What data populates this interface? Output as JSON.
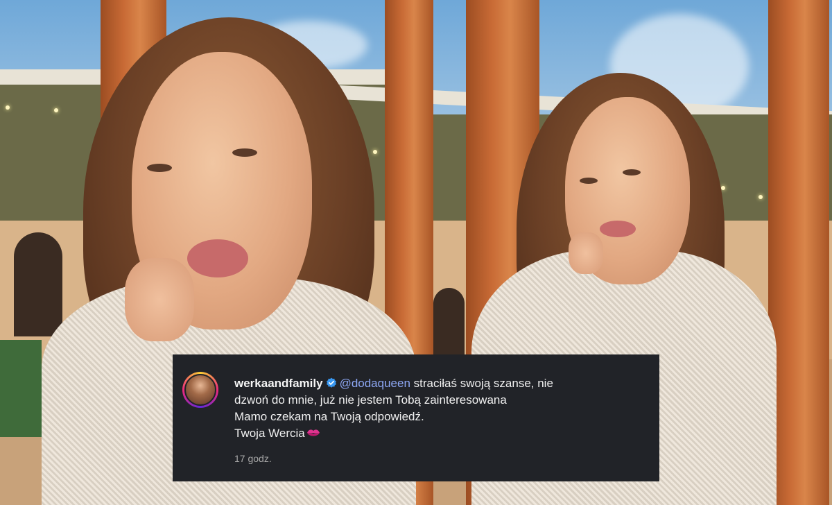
{
  "comment": {
    "username": "werkaandfamily",
    "mention": "@dodaqueen",
    "lines": [
      "straciłaś swoją szanse, nie",
      "dzwoń do mnie, już nie jestem Tobą zainteresowana",
      "Mamo czekam na Twoją odpowiedź.",
      "Twoja Wercia"
    ],
    "timestamp": "17 godz.",
    "icons": {
      "verified": "verified-badge-icon",
      "emoji": "kiss-lips-icon",
      "avatar": "profile-avatar"
    },
    "colors": {
      "background": "#212328",
      "mention": "#8ea8f5",
      "verified": "#3897f0",
      "emoji": "#e0338f"
    }
  }
}
